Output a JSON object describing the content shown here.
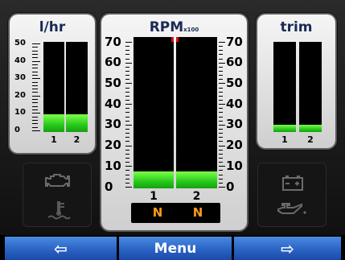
{
  "fuel_flow": {
    "title": "l/hr",
    "scale": [
      "50",
      "40",
      "30",
      "20",
      "10",
      "0"
    ],
    "bars": [
      {
        "label": "1",
        "value": 10
      },
      {
        "label": "2",
        "value": 10
      }
    ],
    "max": 50
  },
  "rpm": {
    "title": "RPM",
    "multiplier": "x100",
    "scale_left": [
      "70",
      "60",
      "50",
      "40",
      "30",
      "20",
      "10",
      "0"
    ],
    "scale_right": [
      "70",
      "60",
      "50",
      "40",
      "30",
      "20",
      "10",
      "0"
    ],
    "bars": [
      {
        "label": "1",
        "value": 8,
        "gear": "N"
      },
      {
        "label": "2",
        "value": 8,
        "gear": "N"
      }
    ],
    "max": 70,
    "redline": 68
  },
  "trim": {
    "title": "trim",
    "bars": [
      {
        "label": "1",
        "value": 8
      },
      {
        "label": "2",
        "value": 8
      }
    ],
    "max": 100
  },
  "indicators": {
    "left": [
      "check-engine-icon",
      "coolant-temp-icon"
    ],
    "right": [
      "battery-icon",
      "oil-pressure-icon"
    ]
  },
  "nav": {
    "prev_label": "⇦",
    "menu_label": "Menu",
    "next_label": "⇨"
  },
  "colors": {
    "bar_green": "#27c91b",
    "redline": "#d11111",
    "gear_text": "#ff9a1a",
    "button_blue": "#2a63c4",
    "title_blue": "#1a2a55"
  }
}
